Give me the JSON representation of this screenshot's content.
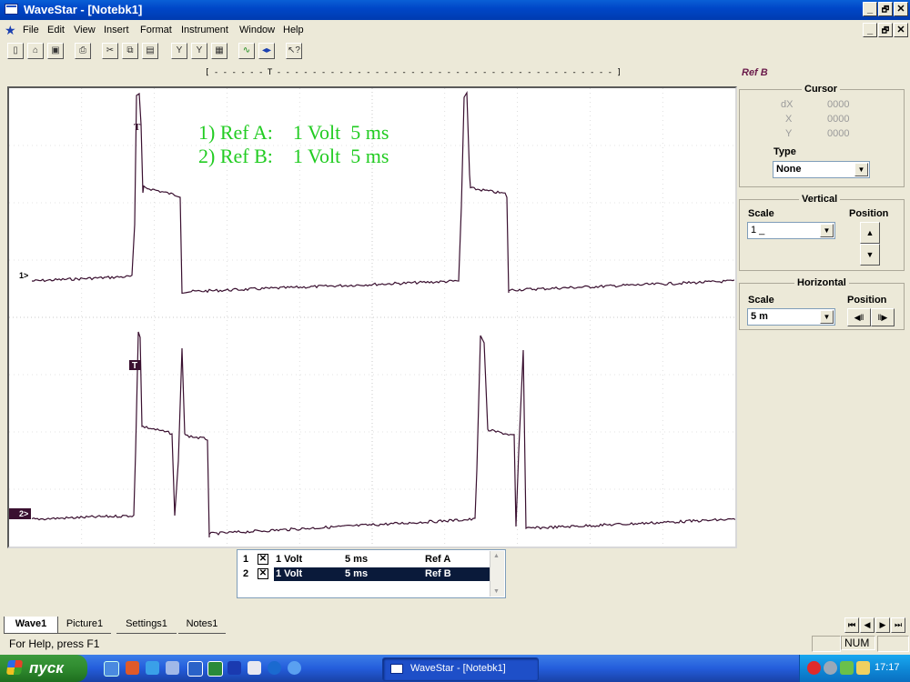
{
  "window": {
    "title": "WaveStar - [Notebk1]",
    "controls": [
      "_",
      "🗗",
      "✕"
    ],
    "doc_controls": [
      "_",
      "🗗",
      "✕"
    ]
  },
  "menu": [
    "File",
    "Edit",
    "View",
    "Insert",
    "Format",
    "Instrument",
    "Window",
    "Help"
  ],
  "ruler": {
    "text": "[ - - - - - - T - - - - - - - - - - - - - - - - - - - - - - - - - - - - - - - - - - - - - - ]"
  },
  "ref_label": "Ref B",
  "scope": {
    "annotation_line1": "1) Ref A:    1 Volt  5 ms",
    "annotation_line2": "2) Ref B:    1 Volt  5 ms",
    "marker1": "1>",
    "marker2": "2>",
    "trigger1": "T",
    "trigger2": "T",
    "trace_color": "#3a1030",
    "annotation_color": "#22cc22"
  },
  "cursor": {
    "title": "Cursor",
    "dx_label": "dX",
    "dx_value": "0000",
    "x_label": "X",
    "x_value": "0000",
    "y_label": "Y",
    "y_value": "0000",
    "type_label": "Type",
    "type_value": "None"
  },
  "vertical": {
    "title": "Vertical",
    "scale_label": "Scale",
    "scale_value": "1 _",
    "position_label": "Position"
  },
  "horizontal": {
    "title": "Horizontal",
    "scale_label": "Scale",
    "scale_value": "5 m",
    "position_label": "Position"
  },
  "channels": [
    {
      "num": "1",
      "volt": "1 Volt",
      "time": "5 ms",
      "ref": "Ref A",
      "checked": "✕"
    },
    {
      "num": "2",
      "volt": "1 Volt",
      "time": "5 ms",
      "ref": "Ref B",
      "checked": "✕"
    }
  ],
  "tabs": [
    "Wave1",
    "Picture1",
    "Settings1",
    "Notes1"
  ],
  "status": {
    "help": "For Help, press F1",
    "num": "NUM"
  },
  "taskbar": {
    "start": "пуск",
    "task": "WaveStar - [Notebk1]",
    "clock": "17:17"
  }
}
